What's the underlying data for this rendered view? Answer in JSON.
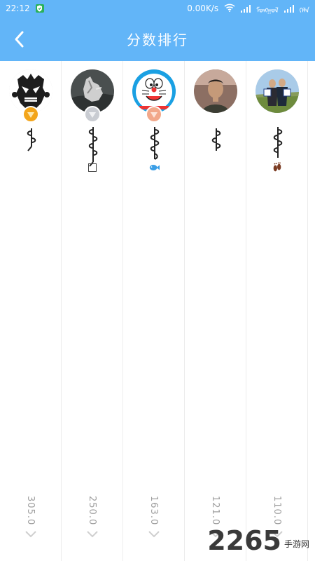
{
  "status_bar": {
    "time": "22:12",
    "net_speed": "0.00K/s",
    "carrier1": "ᠮᠣᠩᠭᠣᠯ",
    "carrier2": "ᠬᠡᠯᠡ",
    "colors": {
      "bar": "#62b5f8",
      "shield": "#2bb15b"
    }
  },
  "app_bar": {
    "title": "分数排行",
    "back_icon": "chevron-left-icon"
  },
  "ranking": {
    "items": [
      {
        "name": "ᠰᠡ",
        "score": "305.0",
        "medal": "gold",
        "avatar": "mask-avatar"
      },
      {
        "name": "ᠪᠢᠯᠢᠭᠲᠦ",
        "score": "250.0",
        "medal": "silver",
        "avatar": "horseman-avatar",
        "extra": "□"
      },
      {
        "name": "ᠮᠠᠩᠭᠠᠳ",
        "score": "163.0",
        "medal": "bronze",
        "avatar": "doraemon-avatar",
        "extra": "🐟"
      },
      {
        "name": "ᠬᠦᠮᠦᠨ",
        "score": "121.0",
        "medal": "",
        "avatar": "man-portrait-avatar"
      },
      {
        "name": "ᠮᠣᠷᠢᠨ",
        "score": "110.0",
        "medal": "",
        "avatar": "couple-avatar",
        "extra": "👣"
      }
    ],
    "colors": {
      "score": "#9e9e9e",
      "divider": "#ececec"
    }
  },
  "watermark": {
    "number": "2265",
    "suffix": "手游网"
  }
}
